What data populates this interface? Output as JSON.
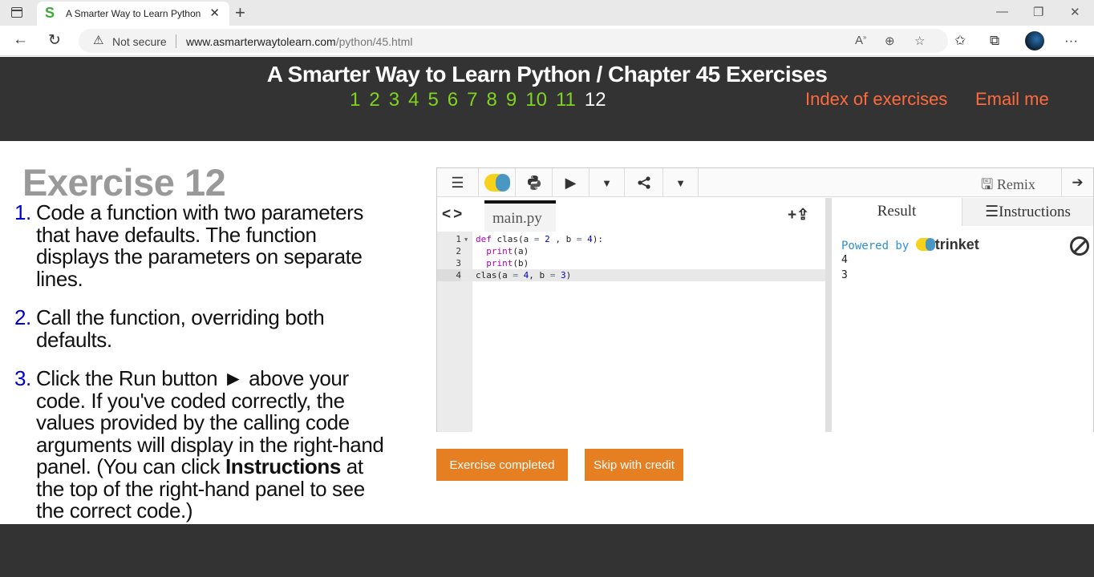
{
  "browser": {
    "tab_title": "A Smarter Way to Learn Python",
    "favicon_letter": "S",
    "security_label": "Not secure",
    "url_host": "www.asmarterwaytolearn.com",
    "url_path": "/python/45.html"
  },
  "site": {
    "title": "A Smarter Way to Learn Python / Chapter 45 Exercises",
    "exercise_numbers": [
      "1",
      "2",
      "3",
      "4",
      "5",
      "6",
      "7",
      "8",
      "9",
      "10",
      "11",
      "12"
    ],
    "current_exercise": "12",
    "index_link": "Index of exercises",
    "email_link": "Email me"
  },
  "exercise": {
    "heading": "Exercise 12",
    "steps": [
      {
        "num": "1.",
        "text": "Code a function with two parameters that have defaults. The function displays the parameters on separate lines."
      },
      {
        "num": "2.",
        "text": "Call the function, overriding both defaults."
      },
      {
        "num": "3.",
        "text_before": "Click the Run button ► above your code. If you've coded correctly, the values provided by the calling code arguments will display in the right-hand panel. (You can click ",
        "bold": "Instructions",
        "text_after": " at the top of the right-hand panel to see the correct code.)"
      }
    ]
  },
  "trinket": {
    "remix_label": "Remix",
    "file_name": "main.py",
    "code_lines": [
      {
        "n": "1",
        "fold": "▼"
      },
      {
        "n": "2",
        "fold": ""
      },
      {
        "n": "3",
        "fold": ""
      },
      {
        "n": "4",
        "fold": ""
      }
    ],
    "tabs": {
      "result": "Result",
      "instructions": "Instructions"
    },
    "powered_by": "Powered by",
    "brand": "trinket",
    "output": [
      "4",
      "3"
    ]
  },
  "buttons": {
    "completed": "Exercise completed",
    "skip": "Skip with credit"
  },
  "colors": {
    "header_bg": "#333333",
    "nav_green": "#7fd321",
    "link_orange": "#ff6a3d",
    "button_orange": "#e67e22"
  },
  "icons": [
    "tab-actions-icon",
    "back-icon",
    "refresh-icon",
    "warning-icon",
    "read-aloud-icon",
    "zoom-icon",
    "add-favorite-icon",
    "favorites-icon",
    "collections-icon",
    "more-icon",
    "menu-icon",
    "trinket-logo-icon",
    "python-icon",
    "run-icon",
    "dropdown-icon",
    "share-icon",
    "remix-icon",
    "sign-in-icon",
    "code-arrows-icon",
    "add-file-icon",
    "upload-icon",
    "list-icon",
    "stop-icon"
  ]
}
